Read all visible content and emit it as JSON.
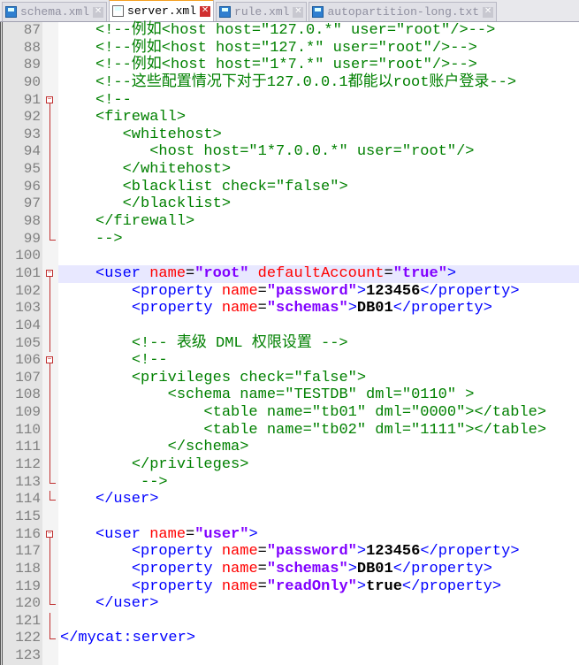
{
  "tabs": [
    {
      "label": "schema.xml",
      "active": false
    },
    {
      "label": "server.xml",
      "active": true
    },
    {
      "label": "rule.xml",
      "active": false
    },
    {
      "label": "autopartition-long.txt",
      "active": false
    }
  ],
  "lines": [
    {
      "n": "87",
      "i": 0,
      "s": [
        [
          "c",
          "<!--例如<host host=\"127.0.*\" user=\"root\"/>-->"
        ]
      ]
    },
    {
      "n": "88",
      "i": 0,
      "s": [
        [
          "c",
          "<!--例如<host host=\"127.*\" user=\"root\"/>-->"
        ]
      ]
    },
    {
      "n": "89",
      "i": 0,
      "s": [
        [
          "c",
          "<!--例如<host host=\"1*7.*\" user=\"root\"/>-->"
        ]
      ]
    },
    {
      "n": "90",
      "i": 0,
      "s": [
        [
          "c",
          "<!--这些配置情况下对于127.0.0.1都能以root账户登录-->"
        ]
      ]
    },
    {
      "n": "91",
      "i": 0,
      "f": "open",
      "s": [
        [
          "c",
          "<!--"
        ]
      ]
    },
    {
      "n": "92",
      "i": 0,
      "f": "line",
      "s": [
        [
          "c",
          "<firewall>"
        ]
      ]
    },
    {
      "n": "93",
      "i": 3,
      "f": "line",
      "s": [
        [
          "c",
          "<whitehost>"
        ]
      ]
    },
    {
      "n": "94",
      "i": 6,
      "f": "line",
      "s": [
        [
          "c",
          "<host host=\"1*7.0.0.*\" user=\"root\"/>"
        ]
      ]
    },
    {
      "n": "95",
      "i": 3,
      "f": "line",
      "s": [
        [
          "c",
          "</whitehost>"
        ]
      ]
    },
    {
      "n": "96",
      "i": 3,
      "f": "line",
      "s": [
        [
          "c",
          "<blacklist check=\"false\">"
        ]
      ]
    },
    {
      "n": "97",
      "i": 3,
      "f": "line",
      "s": [
        [
          "c",
          "</blacklist>"
        ]
      ]
    },
    {
      "n": "98",
      "i": 0,
      "f": "line",
      "s": [
        [
          "c",
          "</firewall>"
        ]
      ]
    },
    {
      "n": "99",
      "i": 0,
      "f": "end",
      "s": [
        [
          "c",
          "-->"
        ]
      ]
    },
    {
      "n": "100",
      "i": 0,
      "s": []
    },
    {
      "n": "101",
      "i": 0,
      "f": "open",
      "hl": true,
      "s": [
        [
          "t",
          "<user "
        ],
        [
          "a",
          "name"
        ],
        [
          "p",
          "="
        ],
        [
          "v",
          "\"root\""
        ],
        [
          "a",
          " defaultAccount"
        ],
        [
          "p",
          "="
        ],
        [
          "v",
          "\"true\""
        ],
        [
          "t",
          ">"
        ]
      ]
    },
    {
      "n": "102",
      "i": 4,
      "f": "line",
      "s": [
        [
          "t",
          "<property "
        ],
        [
          "a",
          "name"
        ],
        [
          "p",
          "="
        ],
        [
          "v",
          "\"password\""
        ],
        [
          "t",
          ">"
        ],
        [
          "x",
          "123456"
        ],
        [
          "t",
          "</property>"
        ]
      ]
    },
    {
      "n": "103",
      "i": 4,
      "f": "line",
      "s": [
        [
          "t",
          "<property "
        ],
        [
          "a",
          "name"
        ],
        [
          "p",
          "="
        ],
        [
          "v",
          "\"schemas\""
        ],
        [
          "t",
          ">"
        ],
        [
          "x",
          "DB01"
        ],
        [
          "t",
          "</property>"
        ]
      ]
    },
    {
      "n": "104",
      "i": 0,
      "f": "line",
      "s": []
    },
    {
      "n": "105",
      "i": 4,
      "f": "line",
      "s": [
        [
          "c",
          "<!-- 表级 DML 权限设置 -->"
        ]
      ]
    },
    {
      "n": "106",
      "i": 4,
      "f": "open",
      "s": [
        [
          "c",
          "<!--"
        ]
      ]
    },
    {
      "n": "107",
      "i": 4,
      "f": "line",
      "s": [
        [
          "c",
          "<privileges check=\"false\">"
        ]
      ]
    },
    {
      "n": "108",
      "i": 8,
      "f": "line",
      "s": [
        [
          "c",
          "<schema name=\"TESTDB\" dml=\"0110\" >"
        ]
      ]
    },
    {
      "n": "109",
      "i": 12,
      "f": "line",
      "s": [
        [
          "c",
          "<table name=\"tb01\" dml=\"0000\"></table>"
        ]
      ]
    },
    {
      "n": "110",
      "i": 12,
      "f": "line",
      "s": [
        [
          "c",
          "<table name=\"tb02\" dml=\"1111\"></table>"
        ]
      ]
    },
    {
      "n": "111",
      "i": 8,
      "f": "line",
      "s": [
        [
          "c",
          "</schema>"
        ]
      ]
    },
    {
      "n": "112",
      "i": 4,
      "f": "line",
      "s": [
        [
          "c",
          "</privileges>"
        ]
      ]
    },
    {
      "n": "113",
      "i": 4,
      "f": "end",
      "s": [
        [
          "c",
          " -->"
        ]
      ]
    },
    {
      "n": "114",
      "i": 0,
      "f": "end",
      "s": [
        [
          "t",
          "</user>"
        ]
      ]
    },
    {
      "n": "115",
      "i": 0,
      "s": []
    },
    {
      "n": "116",
      "i": 0,
      "f": "open",
      "s": [
        [
          "t",
          "<user "
        ],
        [
          "a",
          "name"
        ],
        [
          "p",
          "="
        ],
        [
          "v",
          "\"user\""
        ],
        [
          "t",
          ">"
        ]
      ]
    },
    {
      "n": "117",
      "i": 4,
      "f": "line",
      "s": [
        [
          "t",
          "<property "
        ],
        [
          "a",
          "name"
        ],
        [
          "p",
          "="
        ],
        [
          "v",
          "\"password\""
        ],
        [
          "t",
          ">"
        ],
        [
          "x",
          "123456"
        ],
        [
          "t",
          "</property>"
        ]
      ]
    },
    {
      "n": "118",
      "i": 4,
      "f": "line",
      "s": [
        [
          "t",
          "<property "
        ],
        [
          "a",
          "name"
        ],
        [
          "p",
          "="
        ],
        [
          "v",
          "\"schemas\""
        ],
        [
          "t",
          ">"
        ],
        [
          "x",
          "DB01"
        ],
        [
          "t",
          "</property>"
        ]
      ]
    },
    {
      "n": "119",
      "i": 4,
      "f": "line",
      "s": [
        [
          "t",
          "<property "
        ],
        [
          "a",
          "name"
        ],
        [
          "p",
          "="
        ],
        [
          "v",
          "\"readOnly\""
        ],
        [
          "t",
          ">"
        ],
        [
          "x",
          "true"
        ],
        [
          "t",
          "</property>"
        ]
      ]
    },
    {
      "n": "120",
      "i": 0,
      "f": "end",
      "s": [
        [
          "t",
          "</user>"
        ]
      ]
    },
    {
      "n": "121",
      "i": 0,
      "f": "line",
      "s": []
    },
    {
      "n": "122",
      "i": 0,
      "f": "end",
      "root": true,
      "s": [
        [
          "t",
          "</mycat:server>"
        ]
      ]
    },
    {
      "n": "123",
      "i": 0,
      "s": []
    }
  ]
}
